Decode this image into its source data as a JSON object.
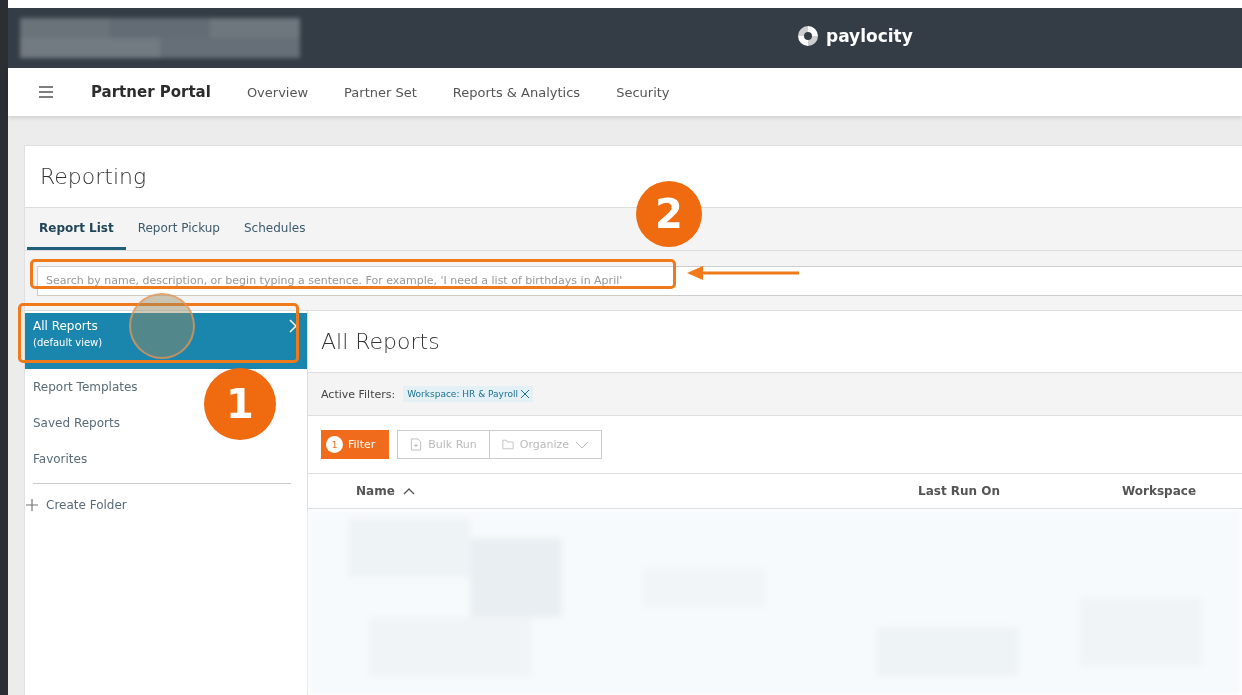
{
  "app_bar": {
    "brand": "paylocity"
  },
  "nav": {
    "title": "Partner Portal",
    "links": [
      "Overview",
      "Partner Set",
      "Reports & Analytics",
      "Security"
    ]
  },
  "page": {
    "title": "Reporting",
    "tabs": [
      {
        "label": "Report List",
        "selected": true
      },
      {
        "label": "Report Pickup",
        "selected": false
      },
      {
        "label": "Schedules",
        "selected": false
      }
    ],
    "search": {
      "placeholder": "Search by name, description, or begin typing a sentence. For example, 'I need a list of birthdays in April'"
    }
  },
  "sidebar": {
    "items": [
      {
        "label": "All Reports",
        "sublabel": "(default view)",
        "selected": true
      },
      {
        "label": "Report Templates",
        "selected": false
      },
      {
        "label": "Saved Reports",
        "selected": false
      },
      {
        "label": "Favorites",
        "selected": false
      }
    ],
    "create_folder": "Create Folder"
  },
  "main": {
    "title": "All Reports",
    "active_filters_label": "Active Filters:",
    "filters": [
      "Workspace: HR & Payroll"
    ],
    "toolbar": [
      {
        "kind": "filter",
        "label": "Filter",
        "count": "1"
      },
      {
        "kind": "bulk_run",
        "label": "Bulk Run",
        "disabled": true
      },
      {
        "kind": "organize",
        "label": "Organize",
        "disabled": true
      }
    ],
    "columns": [
      {
        "label": "Name",
        "sorted": true
      },
      {
        "label": "Last Run On",
        "sorted": false
      },
      {
        "label": "Workspace",
        "sorted": false
      }
    ]
  },
  "annotations": [
    {
      "kind": "frame"
    },
    {
      "kind": "frame"
    },
    {
      "kind": "click"
    },
    {
      "kind": "badge",
      "number": "2"
    },
    {
      "kind": "badge",
      "number": "1"
    },
    {
      "kind": "arrow"
    }
  ]
}
